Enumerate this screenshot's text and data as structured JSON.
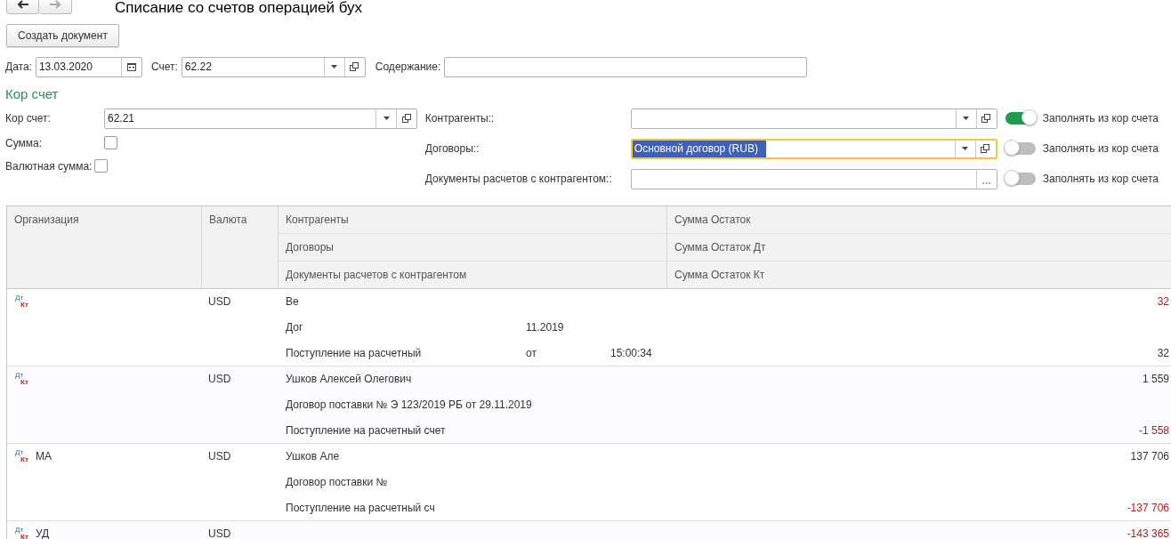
{
  "window": {
    "title": "Списание со счетов операцией бух"
  },
  "nav": [
    {
      "kind": "back",
      "disabled": false
    },
    {
      "kind": "forward",
      "disabled": true
    }
  ],
  "toolbar": {
    "buttons": [
      "Создать документ"
    ]
  },
  "header_fields": [
    {
      "label": "Дата:",
      "kind": "date",
      "value": "13.03.2020"
    },
    {
      "label": "Счет:",
      "kind": "select",
      "value": "62.22"
    },
    {
      "label": "Содержание:",
      "kind": "text"
    }
  ],
  "section_title": "Кор счет",
  "left_fields": [
    {
      "label": "Кор счет:",
      "kind": "select",
      "value": "62.21"
    },
    {
      "label": "Сумма:",
      "kind": "checkbox",
      "checked": false
    },
    {
      "label": "Валютная сумма:",
      "kind": "checkbox",
      "checked": false
    }
  ],
  "right_fields": [
    {
      "label": "Контрагенты::",
      "kind": "select",
      "focused": false,
      "toggle": {
        "label": "Заполнять из кор счета",
        "on": true
      }
    },
    {
      "label": "Договоры::",
      "kind": "select",
      "value": "Основной договор (RUB)",
      "focused": true,
      "toggle": {
        "label": "Заполнять из кор счета",
        "on": false
      }
    },
    {
      "label": "Документы расчетов с контрагентом::",
      "kind": "choice",
      "focused": false,
      "toggle": {
        "label": "Заполнять из кор счета",
        "on": false
      }
    }
  ],
  "table": {
    "columns": [
      {
        "lines": [
          "Организация"
        ]
      },
      {
        "lines": [
          "Валюта"
        ]
      },
      {
        "lines": [
          "Контрагенты",
          "Договоры",
          "Документы расчетов с контрагентом"
        ]
      },
      {
        "lines": [
          "Сумма Остаток",
          "Сумма Остаток Дт",
          "Сумма Остаток Кт"
        ]
      }
    ],
    "rows": [
      {
        "icon": [
          "Дт",
          "Кт"
        ],
        "currency": "USD",
        "lines": [
          {
            "parts": [
              "Ве"
            ],
            "amount": "32",
            "negative": true
          },
          {
            "parts": [
              "Дог",
              "11.2019"
            ]
          },
          {
            "parts": [
              "Поступление на расчетный",
              "от",
              "15:00:34"
            ],
            "amount": "32",
            "negative": false
          }
        ]
      },
      {
        "icon": [
          "Дт",
          "Кт"
        ],
        "currency": "USD",
        "lines": [
          {
            "parts": [
              "Ушков Алексей Олегович"
            ],
            "amount": "1 559",
            "negative": false
          },
          {
            "parts": [
              "Договор поставки № Э 123/2019 РБ от 29.11.2019"
            ]
          },
          {
            "parts": [
              "Поступление на расчетный счет"
            ],
            "amount": "-1 558",
            "negative": true
          }
        ]
      },
      {
        "icon": [
          "Дт",
          "Кт"
        ],
        "organization": "МА",
        "currency": "USD",
        "lines": [
          {
            "parts": [
              "Ушков Але"
            ],
            "amount": "137 706",
            "negative": false
          },
          {
            "parts": [
              "Договор поставки №"
            ]
          },
          {
            "parts": [
              "Поступление на расчетный сч"
            ],
            "amount": "-137 706",
            "negative": true
          }
        ]
      },
      {
        "icon": [
          "Дт",
          "Кт"
        ],
        "organization": "УД",
        "currency": "USD",
        "lines": [
          {
            "amount": "-143 365",
            "negative": true
          }
        ]
      }
    ]
  }
}
